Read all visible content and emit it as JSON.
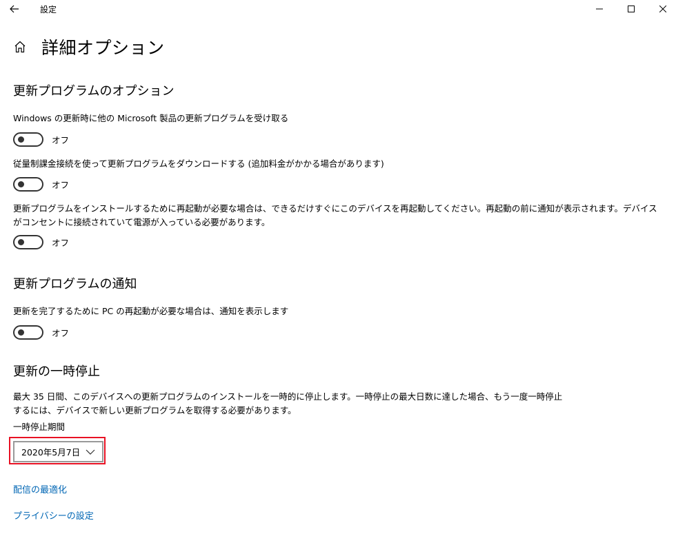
{
  "window": {
    "app_title": "設定"
  },
  "page": {
    "title": "詳細オプション"
  },
  "update_options": {
    "heading": "更新プログラムのオプション",
    "items": [
      {
        "label": "Windows の更新時に他の Microsoft 製品の更新プログラムを受け取る",
        "state": "オフ"
      },
      {
        "label": "従量制課金接続を使って更新プログラムをダウンロードする (追加料金がかかる場合があります)",
        "state": "オフ"
      },
      {
        "label": "更新プログラムをインストールするために再起動が必要な場合は、できるだけすぐにこのデバイスを再起動してください。再起動の前に通知が表示されます。デバイスがコンセントに接続されていて電源が入っている必要があります。",
        "state": "オフ"
      }
    ]
  },
  "notifications": {
    "heading": "更新プログラムの通知",
    "label": "更新を完了するために PC の再起動が必要な場合は、通知を表示します",
    "state": "オフ"
  },
  "pause": {
    "heading": "更新の一時停止",
    "description": "最大 35 日間、このデバイスへの更新プログラムのインストールを一時的に停止します。一時停止の最大日数に達した場合、もう一度一時停止するには、デバイスで新しい更新プログラムを取得する必要があります。",
    "period_label": "一時停止期間",
    "selected_date": "2020年5月7日"
  },
  "links": {
    "delivery_optimization": "配信の最適化",
    "privacy_settings": "プライバシーの設定"
  },
  "colors": {
    "link": "#0066b4",
    "highlight_outline": "#e81123"
  },
  "icons": {
    "back": "arrow-left-icon",
    "home": "home-icon",
    "minimize": "minimize-icon",
    "maximize": "maximize-icon",
    "close": "close-icon",
    "dropdown": "chevron-down-icon"
  }
}
